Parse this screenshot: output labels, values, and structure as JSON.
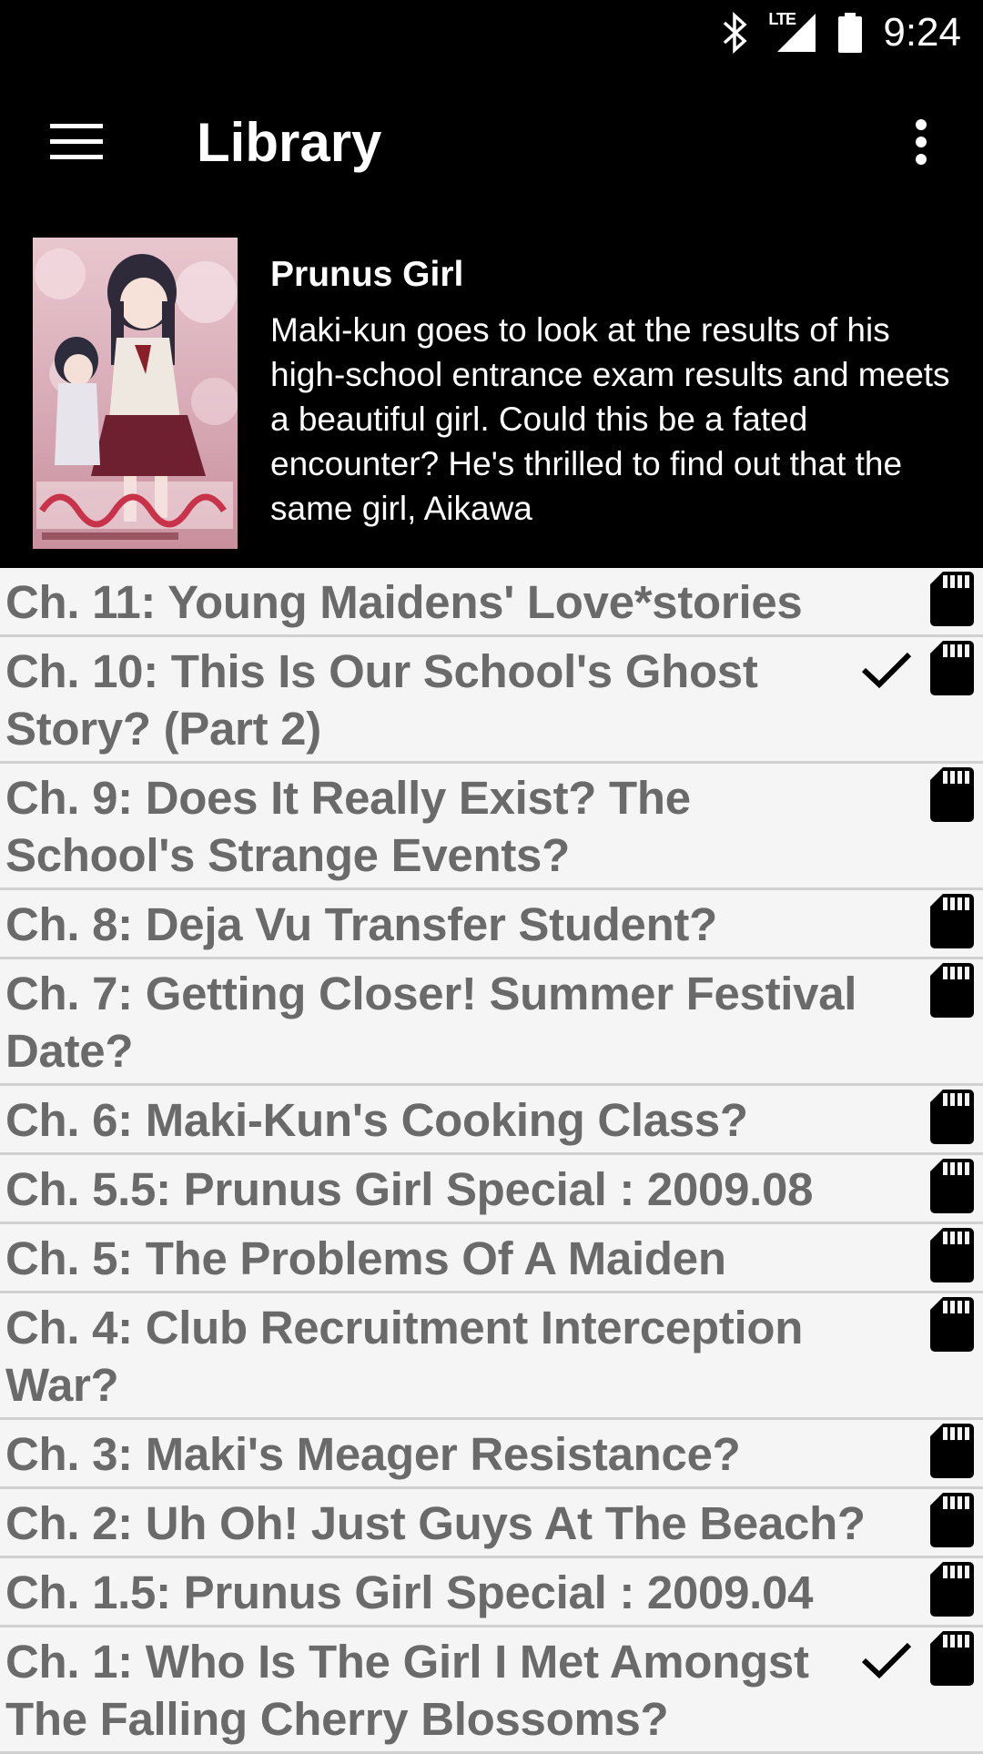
{
  "status_bar": {
    "network_label": "LTE",
    "time": "9:24"
  },
  "app_bar": {
    "title": "Library",
    "menu_icon": "hamburger-menu-icon",
    "overflow_icon": "overflow-menu-icon"
  },
  "manga": {
    "title": "Prunus Girl",
    "description": "Maki-kun goes to look at the results of his high-school entrance exam results and meets a beautiful girl. Could this be a fated encounter? He's thrilled to find out that the same girl, Aikawa"
  },
  "chapters": [
    {
      "title": "Ch. 11: Young Maidens' Love*stories",
      "read": false,
      "downloaded": true
    },
    {
      "title": "Ch. 10: This Is Our School's Ghost Story? (Part 2)",
      "read": true,
      "downloaded": true
    },
    {
      "title": "Ch. 9: Does It Really Exist? The School's Strange Events?",
      "read": false,
      "downloaded": true
    },
    {
      "title": "Ch. 8: Deja Vu Transfer Student?",
      "read": false,
      "downloaded": true
    },
    {
      "title": "Ch. 7: Getting Closer! Summer Festival Date?",
      "read": false,
      "downloaded": true
    },
    {
      "title": "Ch. 6: Maki-Kun's Cooking Class?",
      "read": false,
      "downloaded": true
    },
    {
      "title": "Ch. 5.5: Prunus Girl Special : 2009.08",
      "read": false,
      "downloaded": true
    },
    {
      "title": "Ch. 5: The Problems Of A Maiden",
      "read": false,
      "downloaded": true
    },
    {
      "title": "Ch. 4: Club Recruitment Interception War?",
      "read": false,
      "downloaded": true
    },
    {
      "title": "Ch. 3: Maki's Meager Resistance?",
      "read": false,
      "downloaded": true
    },
    {
      "title": "Ch. 2: Uh Oh! Just Guys At The Beach?",
      "read": false,
      "downloaded": true
    },
    {
      "title": "Ch. 1.5: Prunus Girl Special : 2009.04",
      "read": false,
      "downloaded": true
    },
    {
      "title": "Ch. 1: Who Is The Girl I Met Amongst The Falling Cherry Blossoms?",
      "read": true,
      "downloaded": true
    }
  ],
  "colors": {
    "bar_background": "#000000",
    "list_background": "#f5f5f5",
    "chapter_text": "#6a6a6a",
    "divider": "#d0d0d0"
  }
}
